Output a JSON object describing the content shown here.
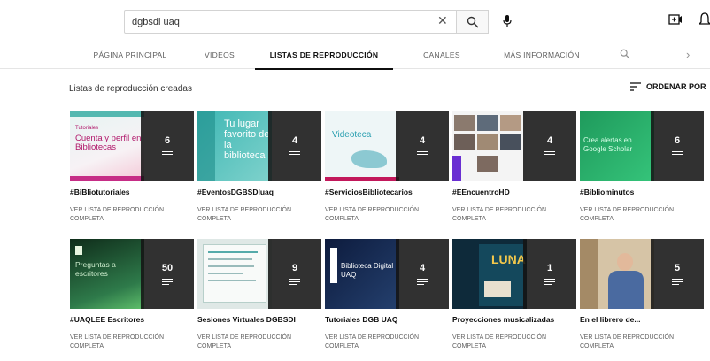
{
  "search": {
    "value": "dgbsdi uaq"
  },
  "tabs": [
    {
      "label": "PÁGINA PRINCIPAL"
    },
    {
      "label": "VIDEOS"
    },
    {
      "label": "LISTAS DE REPRODUCCIÓN"
    },
    {
      "label": "CANALES"
    },
    {
      "label": "MÁS INFORMACIÓN"
    }
  ],
  "section": {
    "title": "Listas de reproducción creadas",
    "sort_label": "ORDENAR POR"
  },
  "playlists": [
    {
      "title": "#BiBliotutoriales",
      "count": "6",
      "link": "VER LISTA DE REPRODUCCIÓN COMPLETA",
      "art_text": "Cuenta y perfil en Bibliotecas",
      "art_small": "Tutoriales"
    },
    {
      "title": "#EventosDGBSDIuaq",
      "count": "4",
      "link": "VER LISTA DE REPRODUCCIÓN COMPLETA",
      "art_text": "Tu lugar favorito de la biblioteca"
    },
    {
      "title": "#ServiciosBibliotecarios",
      "count": "4",
      "link": "VER LISTA DE REPRODUCCIÓN COMPLETA",
      "art_text": "Videoteca"
    },
    {
      "title": "#EEncuentroHD",
      "count": "4",
      "link": "VER LISTA DE REPRODUCCIÓN COMPLETA"
    },
    {
      "title": "#Bibliominutos",
      "count": "6",
      "link": "VER LISTA DE REPRODUCCIÓN COMPLETA",
      "art_text": "Crea alertas en Google Scholar"
    },
    {
      "title": "#UAQLEE Escritores",
      "count": "50",
      "link": "VER LISTA DE REPRODUCCIÓN COMPLETA",
      "art_text": "Preguntas a escritores"
    },
    {
      "title": "Sesiones Virtuales DGBSDI",
      "count": "9",
      "link": "VER LISTA DE REPRODUCCIÓN COMPLETA"
    },
    {
      "title": "Tutoriales DGB UAQ",
      "count": "4",
      "link": "VER LISTA DE REPRODUCCIÓN COMPLETA",
      "art_text": "Biblioteca Digital UAQ"
    },
    {
      "title": "Proyecciones musicalizadas",
      "count": "1",
      "link": "VER LISTA DE REPRODUCCIÓN COMPLETA",
      "art_text": "LUNA"
    },
    {
      "title": "En el librero de...",
      "count": "5",
      "link": "VER LISTA DE REPRODUCCIÓN COMPLETA"
    }
  ]
}
